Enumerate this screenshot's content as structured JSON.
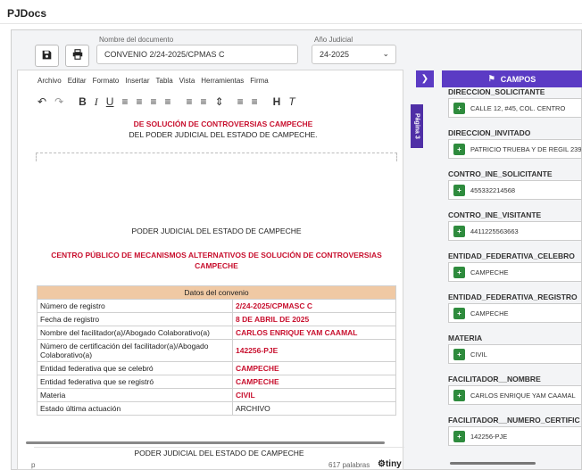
{
  "app": {
    "title": "PJDocs"
  },
  "header": {
    "doc_name_label": "Nombre del documento",
    "doc_name_value": "CONVENIO 2/24-2025/CPMAS C",
    "year_label": "Año Judicial",
    "year_value": "24-2025"
  },
  "editor": {
    "menu": [
      "Archivo",
      "Editar",
      "Formato",
      "Insertar",
      "Tabla",
      "Vista",
      "Herramientas",
      "Firma"
    ],
    "page_tab": "Página 3",
    "top_line_red": "DE SOLUCIÓN DE CONTROVERSIAS CAMPECHE",
    "top_line_black": "DEL PODER JUDICIAL DEL ESTADO DE CAMPECHE.",
    "section_heading": "PODER JUDICIAL DEL ESTADO DE CAMPECHE",
    "section_sub": "CENTRO PÚBLICO DE MECANISMOS ALTERNATIVOS DE SOLUCIÓN DE CONTROVERSIAS CAMPECHE",
    "table_header": "Datos del convenio",
    "rows": [
      {
        "k": "Número de registro",
        "v": "2/24-2025/CPMASC C"
      },
      {
        "k": "Fecha de registro",
        "v": "8 DE ABRIL DE 2025"
      },
      {
        "k": "Nombre del facilitador(a)/Abogado Colaborativo(a)",
        "v": "CARLOS ENRIQUE YAM CAAMAL"
      },
      {
        "k": "Número de certificación del facilitador(a)/Abogado Colaborativo(a)",
        "v": "142256-PJE"
      },
      {
        "k": "Entidad federativa que se celebró",
        "v": "CAMPECHE"
      },
      {
        "k": "Entidad federativa que se registró",
        "v": "CAMPECHE"
      },
      {
        "k": "Materia",
        "v": "CIVIL"
      },
      {
        "k": "Estado última actuación",
        "v": "ARCHIVO"
      }
    ],
    "footer_title": "PODER JUDICIAL DEL ESTADO DE CAMPECHE",
    "status_path": "p",
    "word_count": "617 palabras",
    "brand": "tiny"
  },
  "campos": {
    "header": "CAMPOS",
    "items": [
      {
        "title": "DIRECCION_SOLICITANTE",
        "value": "CALLE 12, #45, COL. CENTRO"
      },
      {
        "title": "DIRECCION_INVITADO",
        "value": "PATRICIO TRUEBA Y DE REGIL 239"
      },
      {
        "title": "CONTRO_INE_SOLICITANTE",
        "value": "455332214568"
      },
      {
        "title": "CONTRO_INE_VISITANTE",
        "value": "4411225563663"
      },
      {
        "title": "ENTIDAD_FEDERATIVA_CELEBRO",
        "value": "CAMPECHE"
      },
      {
        "title": "ENTIDAD_FEDERATIVA_REGISTRO",
        "value": "CAMPECHE"
      },
      {
        "title": "MATERIA",
        "value": "CIVIL"
      },
      {
        "title": "FACILITADOR__NOMBRE",
        "value": "CARLOS ENRIQUE YAM CAAMAL"
      },
      {
        "title": "FACILITADOR__NUMERO_CERTIFIC",
        "value": "142256-PJE"
      }
    ]
  },
  "colors": {
    "accent": "#5b3bc4",
    "page_tab": "#4f2fa6",
    "red_text": "#c8102e",
    "table_header": "#f0c9a4",
    "add_button": "#2e8b3d"
  },
  "icons": {
    "save": "save-icon",
    "print": "print-icon",
    "undo": "undo-icon",
    "redo": "redo-icon",
    "bold": "bold-icon",
    "italic": "italic-icon",
    "underline": "underline-icon",
    "align": "align-icon",
    "chevron": "chevron-right-icon",
    "campos": "tags-icon",
    "add": "add-icon"
  }
}
